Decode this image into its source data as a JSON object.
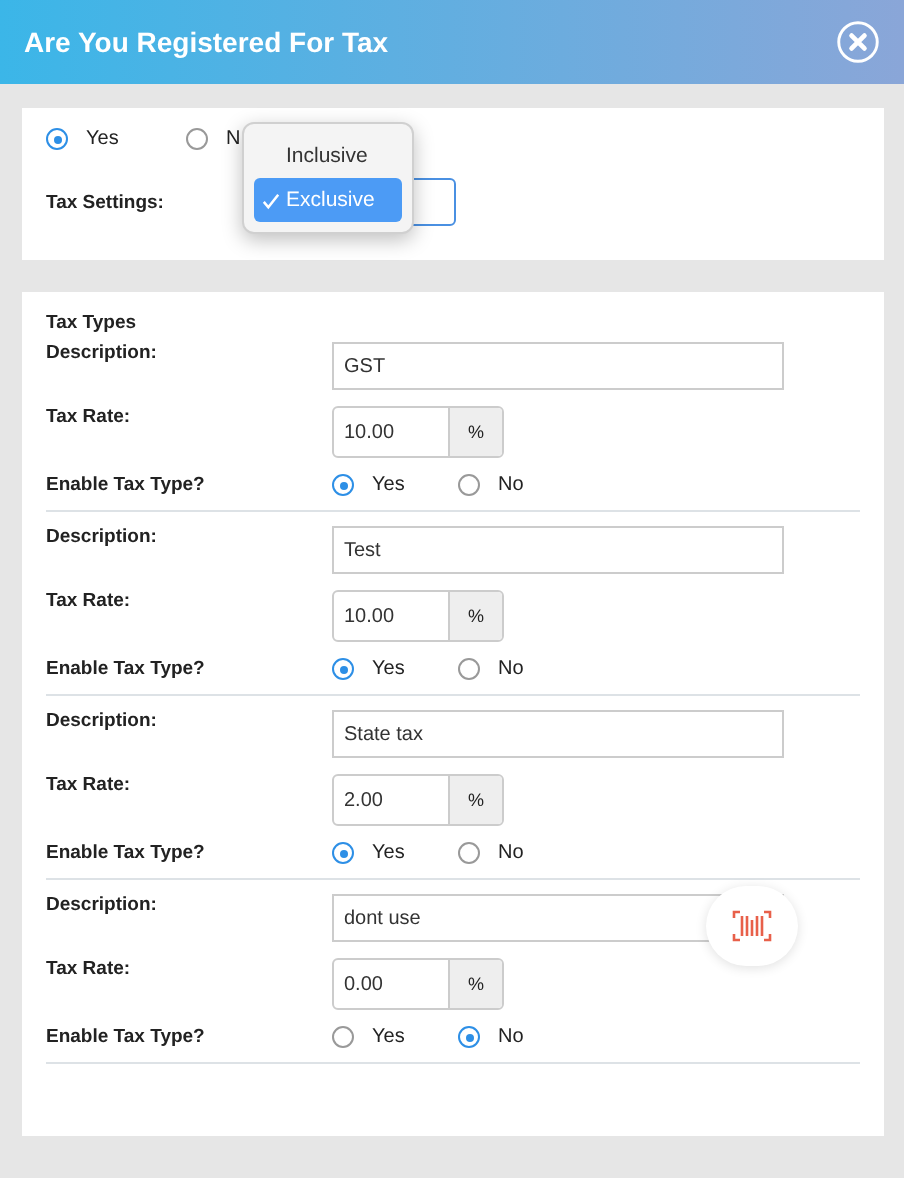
{
  "header": {
    "title": "Are You Registered For Tax"
  },
  "registered": [
    {
      "label": "Yes",
      "selected": true
    },
    {
      "label": "N",
      "selected": false
    }
  ],
  "tax_settings": {
    "label": "Tax Settings:",
    "options": [
      {
        "label": "Inclusive",
        "selected": false
      },
      {
        "label": "Exclusive",
        "selected": true
      }
    ]
  },
  "tax_types": {
    "title": "Tax Types",
    "items": [
      {
        "description_label": "Description:",
        "description": "GST",
        "rate_label": "Tax Rate:",
        "rate": "10.00",
        "unit": "%",
        "enable_label": "Enable Tax Type?",
        "options": [
          {
            "label": "Yes",
            "selected": true
          },
          {
            "label": "No",
            "selected": false
          }
        ]
      },
      {
        "description_label": "Description:",
        "description": "Test",
        "rate_label": "Tax Rate:",
        "rate": "10.00",
        "unit": "%",
        "enable_label": "Enable Tax Type?",
        "options": [
          {
            "label": "Yes",
            "selected": true
          },
          {
            "label": "No",
            "selected": false
          }
        ]
      },
      {
        "description_label": "Description:",
        "description": "State tax",
        "rate_label": "Tax Rate:",
        "rate": "2.00",
        "unit": "%",
        "enable_label": "Enable Tax Type?",
        "options": [
          {
            "label": "Yes",
            "selected": true
          },
          {
            "label": "No",
            "selected": false
          }
        ]
      },
      {
        "description_label": "Description:",
        "description": "dont use",
        "rate_label": "Tax Rate:",
        "rate": "0.00",
        "unit": "%",
        "enable_label": "Enable Tax Type?",
        "options": [
          {
            "label": "Yes",
            "selected": false
          },
          {
            "label": "No",
            "selected": true
          }
        ]
      }
    ]
  }
}
